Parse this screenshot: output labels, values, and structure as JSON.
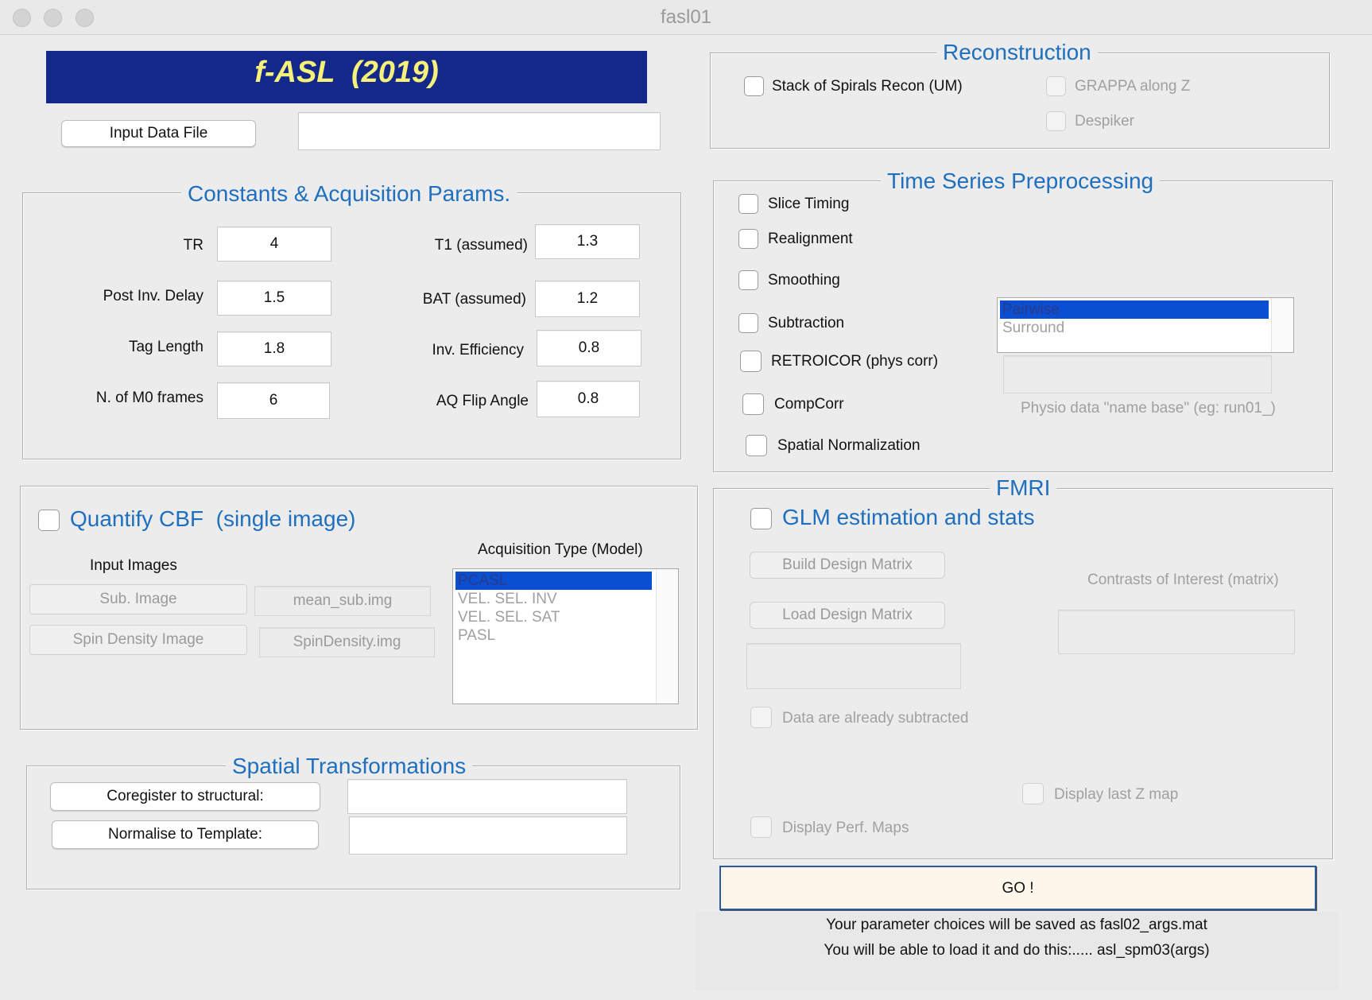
{
  "window": {
    "title": "fasl01"
  },
  "header": {
    "banner": "f-ASL  (2019)",
    "input_button": "Input Data File",
    "input_value": ""
  },
  "constants": {
    "title": "Constants & Acquisition Params.",
    "tr_label": "TR",
    "tr": "4",
    "t1_label": "T1 (assumed)",
    "t1": "1.3",
    "pid_label": "Post Inv. Delay",
    "pid": "1.5",
    "bat_label": "BAT (assumed)",
    "bat": "1.2",
    "tag_label": "Tag Length",
    "tag": "1.8",
    "inv_label": "Inv. Efficiency",
    "inv": "0.8",
    "m0_label": "N. of M0 frames",
    "m0": "6",
    "flip_label": "AQ Flip Angle",
    "flip": "0.8"
  },
  "quantify": {
    "title": "Quantify CBF  (single image)",
    "input_images_label": "Input Images",
    "sub_button": "Sub. Image",
    "sub_value": "mean_sub.img",
    "spin_button": "Spin Density Image",
    "spin_value": "SpinDensity.img",
    "acq_label": "Acquisition Type (Model)",
    "acq_types": [
      "PCASL",
      "VEL. SEL. INV",
      "VEL. SEL. SAT",
      "PASL"
    ]
  },
  "spatial": {
    "title": "Spatial Transformations",
    "coreg_button": "Coregister to structural:",
    "coreg_value": "",
    "norm_button": "Normalise to Template:",
    "norm_value": ""
  },
  "recon": {
    "title": "Reconstruction",
    "spirals": "Stack of Spirals Recon (UM)",
    "grappa": "GRAPPA along Z",
    "despiker": "Despiker"
  },
  "preproc": {
    "title": "Time Series Preprocessing",
    "slice_timing": "Slice Timing",
    "realignment": "Realignment",
    "smoothing": "Smoothing",
    "subtraction": "Subtraction",
    "retroicor": "RETROICOR (phys corr)",
    "compcorr": "CompCorr",
    "spatial_norm": "Spatial Normalization",
    "sub_options": [
      "Pairwise",
      "Surround"
    ],
    "physio_value": "",
    "physio_label": "Physio data \"name base\" (eg: run01_)"
  },
  "fmri": {
    "title": "FMRI",
    "glm": "GLM estimation and stats",
    "build": "Build Design Matrix",
    "load": "Load Design Matrix",
    "contrasts_label": "Contrasts of Interest (matrix)",
    "subtracted": "Data are already subtracted",
    "display_z": "Display last Z map",
    "display_perf": "Display Perf. Maps"
  },
  "footer": {
    "go": "GO !",
    "msg1": "Your parameter choices will be saved as fasl02_args.mat",
    "msg2": "You will be able to load it and do this:..... asl_spm03(args)"
  }
}
